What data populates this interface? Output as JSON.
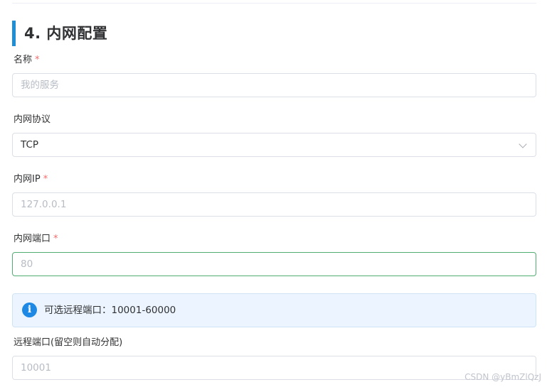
{
  "section": {
    "title": "4. 内网配置"
  },
  "required_marker": "*",
  "fields": {
    "name": {
      "label": "名称",
      "placeholder": "我的服务"
    },
    "protocol": {
      "label": "内网协议",
      "value": "TCP",
      "icon": "chevron-down-icon"
    },
    "ip": {
      "label": "内网IP",
      "placeholder": "127.0.0.1"
    },
    "port": {
      "label": "内网端口",
      "placeholder": "80",
      "focused": true
    },
    "remote_port": {
      "label": "远程端口(留空则自动分配)",
      "placeholder": "10001"
    }
  },
  "alert": {
    "icon": "info-icon",
    "icon_glyph": "i",
    "text": "可选远程端口：10001-60000"
  },
  "watermark": "CSDN @yBmZlQzJ",
  "colors": {
    "accent_bar": "#1e8fd6",
    "required": "#f56c6c",
    "focus_border": "#4fae72",
    "info_bg": "#ecf5ff",
    "info_icon": "#1e88e5"
  }
}
